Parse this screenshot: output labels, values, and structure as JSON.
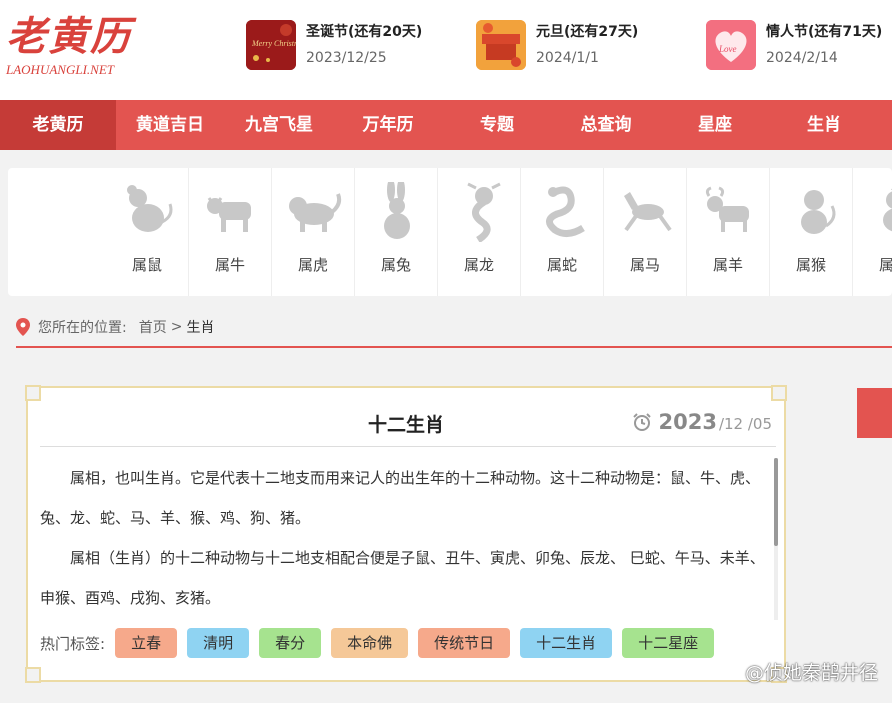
{
  "brand": {
    "logo_cn": "老黄历",
    "logo_en": "LAOHUANGLI.NET",
    "color": "#d9423c"
  },
  "festivals": [
    {
      "title": "圣诞节(还有20天)",
      "date": "2023/12/25",
      "thumb_text": "Merry Christmas"
    },
    {
      "title": "元旦(还有27天)",
      "date": "2024/1/1"
    },
    {
      "title": "情人节(还有71天)",
      "date": "2024/2/14",
      "thumb_text": "Love"
    }
  ],
  "nav": {
    "items": [
      {
        "label": "老黄历",
        "active": true
      },
      {
        "label": "黄道吉日"
      },
      {
        "label": "九宫飞星"
      },
      {
        "label": "万年历"
      },
      {
        "label": "专题"
      },
      {
        "label": "总查询"
      },
      {
        "label": "星座"
      },
      {
        "label": "生肖"
      }
    ],
    "color": "#e35450",
    "active_color": "#c53b37"
  },
  "zodiac": [
    {
      "label": "属鼠",
      "icon": "rat-icon"
    },
    {
      "label": "属牛",
      "icon": "ox-icon"
    },
    {
      "label": "属虎",
      "icon": "tiger-icon"
    },
    {
      "label": "属兔",
      "icon": "rabbit-icon"
    },
    {
      "label": "属龙",
      "icon": "dragon-icon"
    },
    {
      "label": "属蛇",
      "icon": "snake-icon"
    },
    {
      "label": "属马",
      "icon": "horse-icon"
    },
    {
      "label": "属羊",
      "icon": "goat-icon"
    },
    {
      "label": "属猴",
      "icon": "monkey-icon"
    },
    {
      "label": "属鸡",
      "icon": "rooster-icon"
    }
  ],
  "breadcrumb": {
    "prefix": "您所在的位置:",
    "home": "首页",
    "separator": ">",
    "current": "生肖"
  },
  "article": {
    "title": "十二生肖",
    "date_year": "2023",
    "date_md": "/12 /05",
    "paragraphs": [
      "属相，也叫生肖。它是代表十二地支而用来记人的出生年的十二种动物。这十二种动物是：鼠、牛、虎、兔、龙、蛇、马、羊、猴、鸡、狗、猪。",
      "属相（生肖）的十二种动物与十二地支相配合便是子鼠、丑牛、寅虎、卯兔、辰龙、 巳蛇、午马、未羊、申猴、酉鸡、戌狗、亥猪。"
    ]
  },
  "tags": {
    "label": "热门标签:",
    "items": [
      {
        "label": "立春",
        "color": "#f6a98b"
      },
      {
        "label": "清明",
        "color": "#8fd3f2"
      },
      {
        "label": "春分",
        "color": "#a6e38f"
      },
      {
        "label": "本命佛",
        "color": "#f5c898"
      },
      {
        "label": "传统节日",
        "color": "#f6a98b"
      },
      {
        "label": "十二生肖",
        "color": "#8fd3f2"
      },
      {
        "label": "十二星座",
        "color": "#a6e38f"
      }
    ]
  },
  "watermark": "@侦她秦鹊井径"
}
